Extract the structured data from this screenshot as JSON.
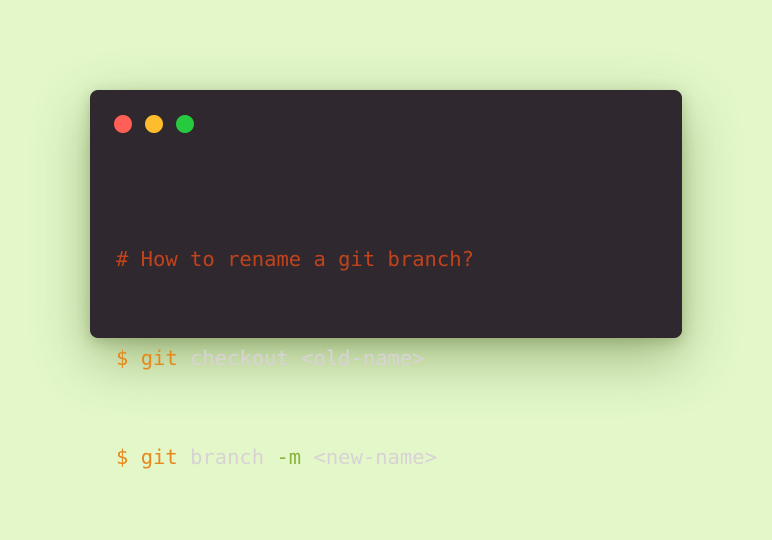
{
  "window": {
    "background": "#2f282e",
    "traffic_lights": [
      {
        "name": "close",
        "color": "#ff5f56"
      },
      {
        "name": "minimize",
        "color": "#ffbd2e"
      },
      {
        "name": "maximize",
        "color": "#27c93f"
      }
    ]
  },
  "colors": {
    "page_background": "#e3f7c9",
    "comment": "#c0431c",
    "keyword": "#e5891c",
    "flag": "#8ab33c",
    "text": "#d8d2d6"
  },
  "code": {
    "line1": {
      "comment": "# How to rename a git branch?"
    },
    "line2": {
      "prompt": "$",
      "command": "git",
      "subcommand": "checkout",
      "argument": "<old-name>"
    },
    "line3": {
      "prompt": "$",
      "command": "git",
      "subcommand": "branch",
      "flag": "-m",
      "argument": "<new-name>"
    }
  }
}
